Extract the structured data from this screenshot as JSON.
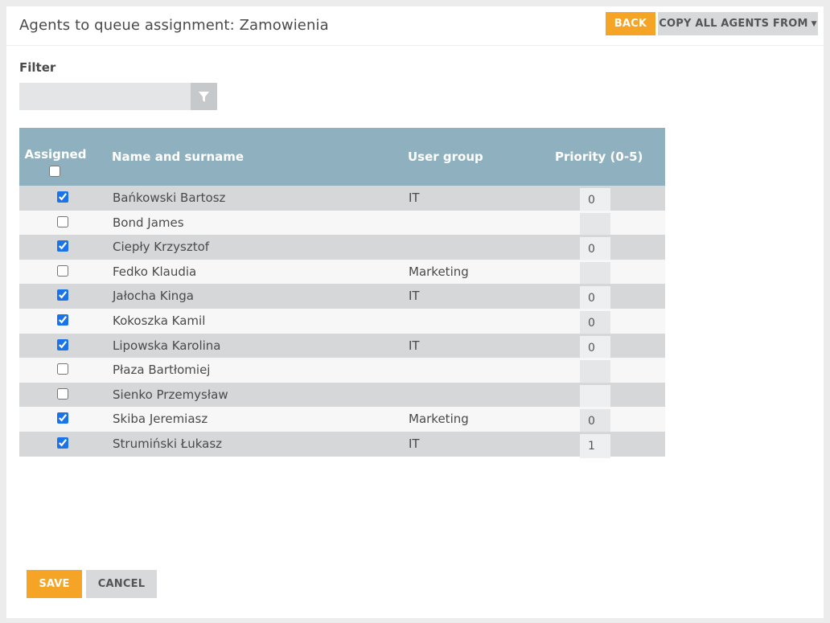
{
  "header": {
    "title": "Agents to queue assignment: Zamowienia",
    "back_label": "BACK",
    "copy_label": "COPY ALL AGENTS FROM"
  },
  "filter": {
    "label": "Filter",
    "value": "",
    "icon": "filter-icon"
  },
  "table": {
    "columns": {
      "assigned": "Assigned",
      "name": "Name and surname",
      "group": "User group",
      "priority": "Priority (0-5)"
    },
    "rows": [
      {
        "assigned": true,
        "name": "Bańkowski Bartosz",
        "group": "IT",
        "priority": "0"
      },
      {
        "assigned": false,
        "name": "Bond James",
        "group": "",
        "priority": ""
      },
      {
        "assigned": true,
        "name": "Ciepły Krzysztof",
        "group": "",
        "priority": "0"
      },
      {
        "assigned": false,
        "name": "Fedko Klaudia",
        "group": "Marketing",
        "priority": ""
      },
      {
        "assigned": true,
        "name": "Jałocha Kinga",
        "group": "IT",
        "priority": "0"
      },
      {
        "assigned": true,
        "name": "Kokoszka Kamil",
        "group": "",
        "priority": "0"
      },
      {
        "assigned": true,
        "name": "Lipowska Karolina",
        "group": "IT",
        "priority": "0"
      },
      {
        "assigned": false,
        "name": "Płaza Bartłomiej",
        "group": "",
        "priority": ""
      },
      {
        "assigned": false,
        "name": "Sienko Przemysław",
        "group": "",
        "priority": ""
      },
      {
        "assigned": true,
        "name": "Skiba Jeremiasz",
        "group": "Marketing",
        "priority": "0"
      },
      {
        "assigned": true,
        "name": "Strumiński Łukasz",
        "group": "IT",
        "priority": "1"
      }
    ]
  },
  "footer": {
    "save_label": "SAVE",
    "cancel_label": "CANCEL"
  },
  "colors": {
    "accent": "#f6a425",
    "header_bg": "#8fb1bf",
    "secondary_button": "#d7d9db"
  }
}
